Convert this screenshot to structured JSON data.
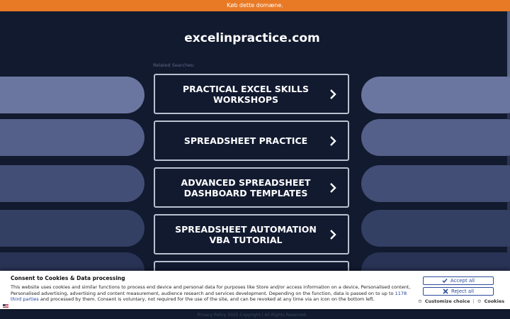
{
  "banner": {
    "text": "Køb dette domæne."
  },
  "page": {
    "domain": "excelinpractice.com",
    "related_label": "Related Searches:",
    "links": [
      {
        "label": "PRACTICAL EXCEL SKILLS WORKSHOPS"
      },
      {
        "label": "SPREADSHEET PRACTICE"
      },
      {
        "label": "ADVANCED SPREADSHEET DASHBOARD TEMPLATES"
      },
      {
        "label": "SPREADSHEET AUTOMATION VBA TUTORIAL"
      },
      {
        "label": ""
      }
    ]
  },
  "cookie": {
    "title": "Consent to Cookies & Data processing",
    "text_before": "This website uses cookies and similar functions to process end device and personal data for purposes like Store and/or access information on a device, Personalised content, Personalised advertising, advertising and content measurement, audience research and services development. Depending on the function, data is passed on to up to ",
    "third_parties_link": "1178 third parties",
    "text_after": " and processed by them. Consent is voluntary, not required for the use of the site, and can be revoked at any time via an icon on the bottom left.",
    "accept_all": "Accept all",
    "reject_all": "Reject all",
    "customize": "Customize choice",
    "separator": "|",
    "cookies": "Cookies"
  },
  "footer": {
    "text": "Privacy Policy  2025 Copyright | All Rights Reserved."
  },
  "colors": {
    "banner": "#e87a26",
    "background": "#111a2e",
    "button_accent": "#2e4c9a"
  }
}
